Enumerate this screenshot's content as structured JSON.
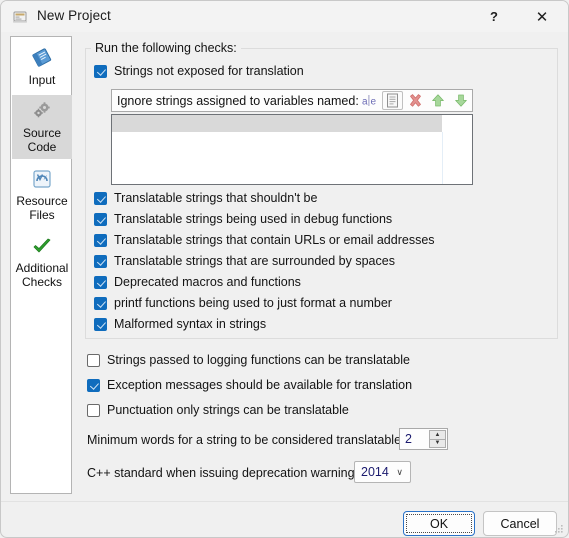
{
  "window": {
    "title": "New Project",
    "icon": "app-window-icon",
    "help_label": "?",
    "close_label": "✕"
  },
  "sidebar": {
    "items": [
      {
        "label": "Input",
        "icon": "blue-book-icon",
        "selected": false
      },
      {
        "label": "Source\nCode",
        "icon": "gears-icon",
        "selected": true
      },
      {
        "label": "Resource\nFiles",
        "icon": "resource-files-icon",
        "selected": false
      },
      {
        "label": "Additional\nChecks",
        "icon": "green-check-icon",
        "selected": false
      }
    ]
  },
  "main": {
    "group_title": "Run the following checks:",
    "primary_check": {
      "label": "Strings not exposed for translation",
      "checked": true
    },
    "ignore_strip": {
      "label": "Ignore strings assigned to variables named:",
      "buttons": [
        {
          "name": "rename-icon",
          "glyph": "a|e"
        },
        {
          "name": "list-document-icon",
          "glyph": "doc"
        },
        {
          "name": "delete-icon",
          "glyph": "x"
        },
        {
          "name": "move-up-icon",
          "glyph": "up"
        },
        {
          "name": "move-down-icon",
          "glyph": "down"
        }
      ]
    },
    "list_items": [],
    "checks": [
      {
        "label": "Translatable strings that shouldn't be",
        "checked": true
      },
      {
        "label": "Translatable strings being used in debug functions",
        "checked": true
      },
      {
        "label": "Translatable strings that contain URLs or email addresses",
        "checked": true
      },
      {
        "label": "Translatable strings that are surrounded by spaces",
        "checked": true
      },
      {
        "label": "Deprecated macros and functions",
        "checked": true
      },
      {
        "label": "printf functions being used to just format a number",
        "checked": true
      },
      {
        "label": "Malformed syntax in strings",
        "checked": true
      }
    ],
    "options": [
      {
        "label": "Strings passed to logging functions can be translatable",
        "checked": false
      },
      {
        "label": "Exception messages should be available for translation",
        "checked": true
      },
      {
        "label": "Punctuation only strings can be translatable",
        "checked": false
      }
    ],
    "min_words": {
      "label": "Minimum words for a string to be considered translatable:",
      "value": "2",
      "up_glyph": "▲",
      "down_glyph": "▼"
    },
    "cpp_standard": {
      "label": "C++ standard when issuing deprecation warnings:",
      "value": "2014",
      "arrow_glyph": "∨"
    }
  },
  "footer": {
    "ok_label": "OK",
    "cancel_label": "Cancel"
  },
  "colors": {
    "accent": "#0f6cbd",
    "default_button_border": "#2a72c8",
    "dialog_bg": "#f0f0f0",
    "titlebar_bg": "#f3f3f3",
    "selected_sidebar": "#d8d8d8"
  }
}
